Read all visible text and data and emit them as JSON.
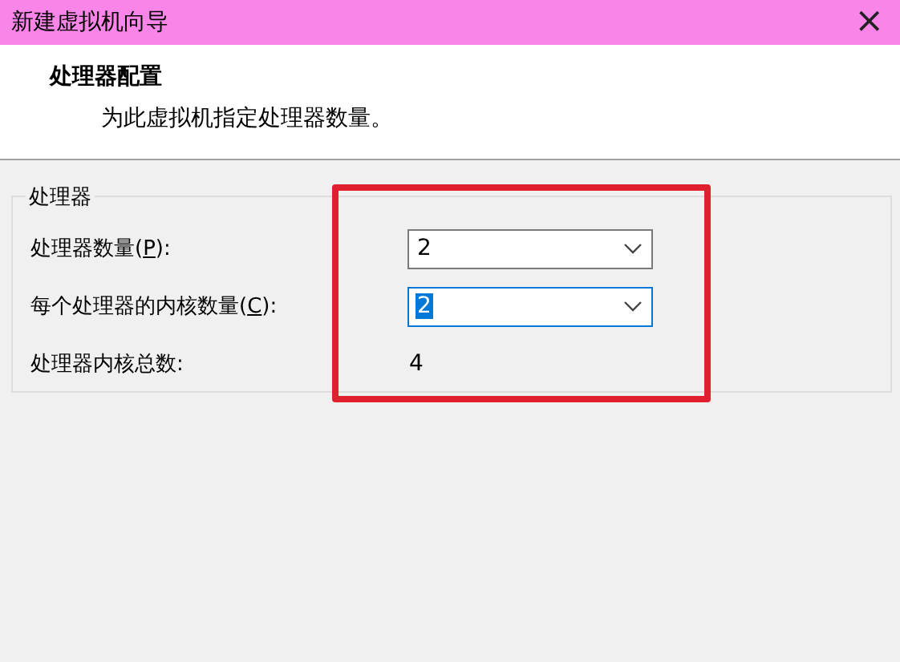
{
  "window": {
    "title": "新建虚拟机向导",
    "close": "×"
  },
  "header": {
    "title": "处理器配置",
    "subtitle": "为此虚拟机指定处理器数量。"
  },
  "group": {
    "legend": "处理器",
    "rows": [
      {
        "kind": "combo",
        "label_before": "处理器数量(",
        "mnemonic": "P",
        "label_after": "):",
        "value": "2",
        "focused": false
      },
      {
        "kind": "combo",
        "label_before": "每个处理器的内核数量(",
        "mnemonic": "C",
        "label_after": "):",
        "value": "2",
        "focused": true
      },
      {
        "kind": "readout",
        "label_before": "处理器内核总数:",
        "value": "4"
      }
    ]
  },
  "annotation": {
    "kind": "highlight-frame"
  }
}
